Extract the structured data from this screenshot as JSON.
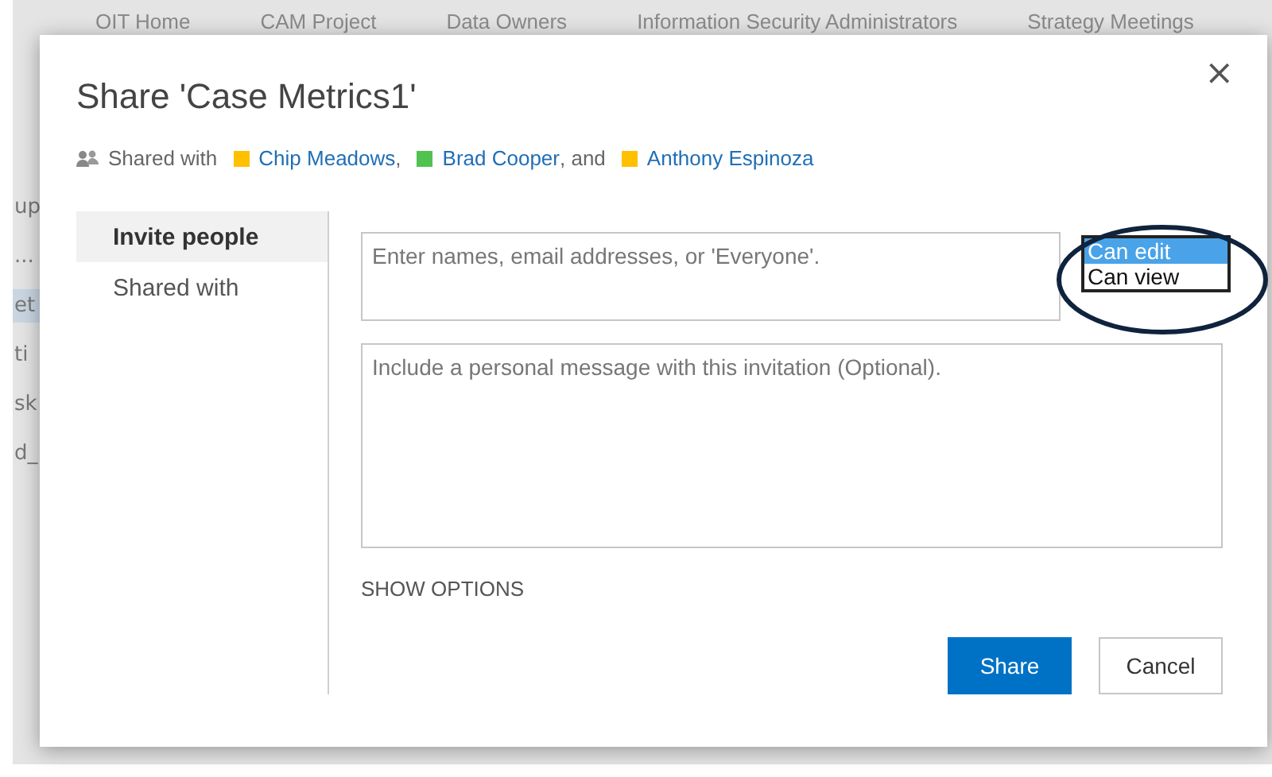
{
  "nav_bar": {
    "items": [
      "OIT Home",
      "CAM Project",
      "Data Owners",
      "Information Security Administrators",
      "Strategy Meetings"
    ]
  },
  "background_fragments": [
    {
      "text": "up",
      "selected": false
    },
    {
      "text": "...",
      "selected": false
    },
    {
      "text": "et",
      "selected": true
    },
    {
      "text": "ti",
      "selected": false
    },
    {
      "text": "sk",
      "selected": false
    },
    {
      "text": "d_",
      "selected": false
    }
  ],
  "dialog": {
    "title": "Share 'Case Metrics1'",
    "close": "×",
    "shared_with": {
      "label": "Shared with",
      "people": [
        {
          "name": "Chip Meadows",
          "color": "#ffc000",
          "after": ","
        },
        {
          "name": "Brad Cooper",
          "color": "#4fc24f",
          "after": ", and"
        },
        {
          "name": "Anthony Espinoza",
          "color": "#ffc000"
        }
      ]
    },
    "side_tabs": [
      {
        "label": "Invite people",
        "selected": true
      },
      {
        "label": "Shared with",
        "selected": false
      }
    ],
    "invite_field": {
      "placeholder": "Enter names, email addresses, or 'Everyone'."
    },
    "permission_list": {
      "options": [
        {
          "label": "Can edit",
          "selected": true
        },
        {
          "label": "Can view",
          "selected": false
        }
      ]
    },
    "message_field": {
      "placeholder": "Include a personal message with this invitation (Optional)."
    },
    "show_options": "SHOW OPTIONS",
    "buttons": [
      {
        "label": "Share",
        "kind": "primary"
      },
      {
        "label": "Cancel",
        "kind": "secondary"
      }
    ]
  }
}
